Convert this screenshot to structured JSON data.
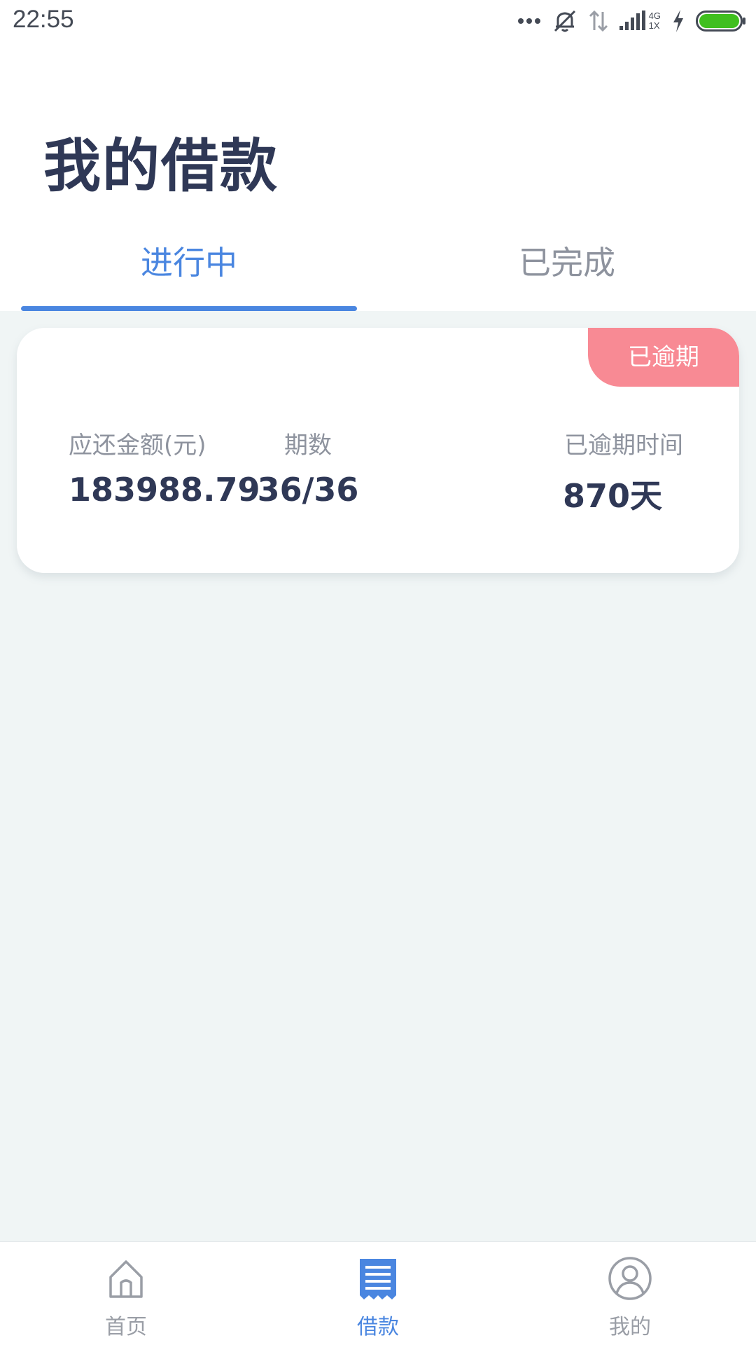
{
  "status_bar": {
    "time": "22:55",
    "network_label_top": "4G",
    "network_label_bottom": "1X"
  },
  "page": {
    "title": "我的借款"
  },
  "tabs": [
    {
      "label": "进行中",
      "active": true
    },
    {
      "label": "已完成",
      "active": false
    }
  ],
  "loan_card": {
    "badge": "已逾期",
    "columns": [
      {
        "label": "应还金额(元)",
        "value": "183988.79"
      },
      {
        "label": "期数",
        "value": "36/36"
      },
      {
        "label": "已逾期时间",
        "value": "870天"
      }
    ]
  },
  "bottom_nav": [
    {
      "label": "首页",
      "icon": "home-icon",
      "active": false
    },
    {
      "label": "借款",
      "icon": "receipt-icon",
      "active": true
    },
    {
      "label": "我的",
      "icon": "user-icon",
      "active": false
    }
  ],
  "colors": {
    "accent": "#4a86e0",
    "title": "#2f3856",
    "muted": "#8e939e",
    "overdue_badge": "#f88a94",
    "background": "#f0f5f5"
  }
}
